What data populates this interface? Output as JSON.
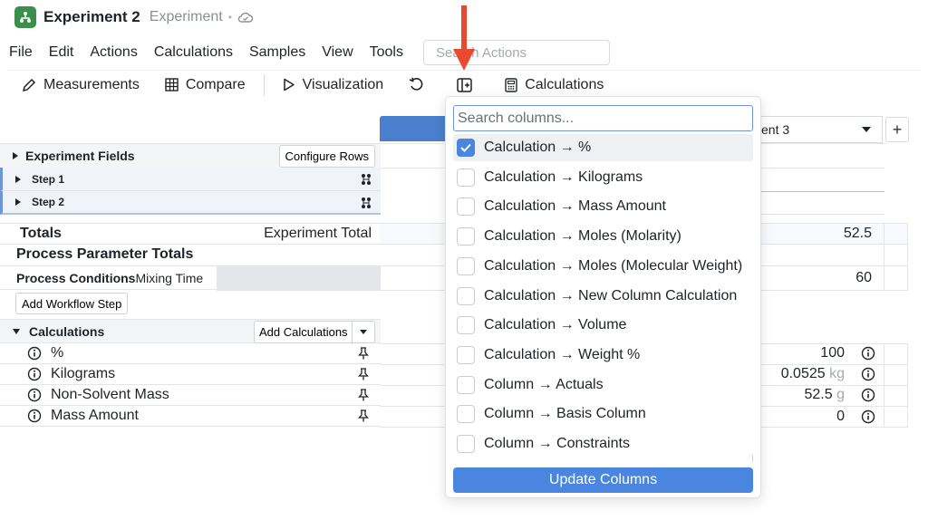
{
  "titlebar": {
    "title": "Experiment 2",
    "type": "Experiment",
    "dot": "•"
  },
  "menu": [
    "File",
    "Edit",
    "Actions",
    "Calculations",
    "Samples",
    "View",
    "Tools"
  ],
  "search_actions": {
    "placeholder": "Search Actions"
  },
  "toolbar": {
    "measurements": "Measurements",
    "compare": "Compare",
    "visualization": "Visualization",
    "calculations": "Calculations"
  },
  "grid": {
    "experiment_fields": "Experiment Fields",
    "configure_rows": "Configure Rows",
    "steps": [
      "Step 1",
      "Step 2"
    ],
    "totals": "Totals",
    "experiment_total": "Experiment Total",
    "process_parameter_totals": "Process Parameter Totals",
    "process_conditions": "Process Conditions",
    "mixing_time": "Mixing Time",
    "add_workflow_step": "Add Workflow Step",
    "calculations": "Calculations",
    "add_calculations": "Add Calculations",
    "calc_rows": [
      "%",
      "Kilograms",
      "Non-Solvent Mass",
      "Mass Amount"
    ],
    "experiment_3_select": "ent 3",
    "plus": "+"
  },
  "values": {
    "total": "52.5",
    "mixing_time": "60",
    "percent": "100",
    "kilograms": "0.0525",
    "kilograms_unit": "kg",
    "non_solvent": "52.5",
    "non_solvent_unit": "g",
    "mass_amount": "0"
  },
  "dropdown": {
    "search_placeholder": "Search columns...",
    "options": [
      {
        "label": "Calculation → %",
        "checked": true
      },
      {
        "label": "Calculation → Kilograms",
        "checked": false
      },
      {
        "label": "Calculation → Mass Amount",
        "checked": false
      },
      {
        "label": "Calculation → Moles (Molarity)",
        "checked": false
      },
      {
        "label": "Calculation → Moles (Molecular Weight)",
        "checked": false
      },
      {
        "label": "Calculation → New Column Calculation",
        "checked": false
      },
      {
        "label": "Calculation → Volume",
        "checked": false
      },
      {
        "label": "Calculation → Weight %",
        "checked": false
      },
      {
        "label": "Column → Actuals",
        "checked": false
      },
      {
        "label": "Column → Basis Column",
        "checked": false
      },
      {
        "label": "Column → Constraints",
        "checked": false
      }
    ],
    "update_button": "Update Columns"
  },
  "colors": {
    "accent": "#4a86e0",
    "app_icon": "#3a8f4a",
    "arrow": "#e8492f"
  }
}
